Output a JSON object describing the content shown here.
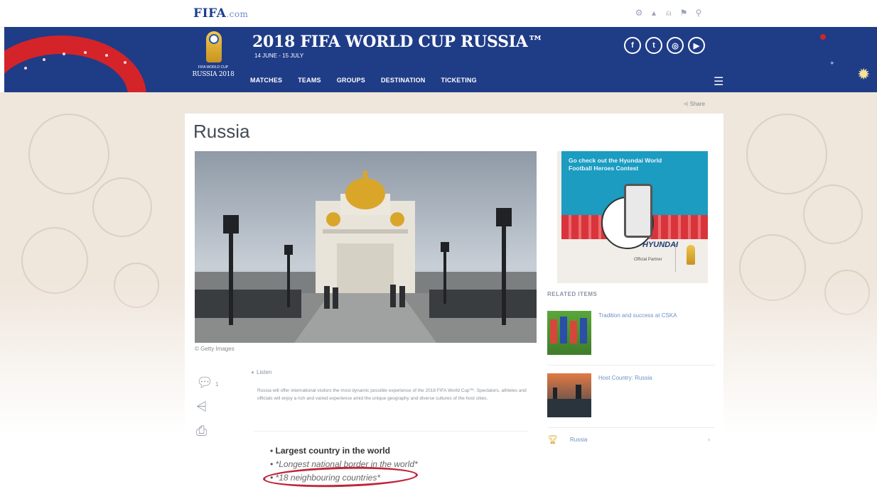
{
  "topbar": {
    "logo_main": "FIFA",
    "logo_suffix": ".com",
    "util_icons": [
      "settings-icon",
      "cart-icon",
      "user-icon",
      "language-icon",
      "search-icon"
    ],
    "util_glyphs": [
      "⚙",
      "▴",
      "⍝",
      "⚑",
      "⚲"
    ]
  },
  "masthead": {
    "title": "2018 FIFA WORLD CUP RUSSIA™",
    "dates": "14 JUNE - 15 JULY",
    "emblem_line1": "FIFA WORLD CUP",
    "emblem_line2": "RUSSIA 2018",
    "nav": [
      "MATCHES",
      "TEAMS",
      "GROUPS",
      "DESTINATION",
      "TICKETING"
    ],
    "social_glyphs": [
      "f",
      "t",
      "◎",
      "▶"
    ],
    "social_names": [
      "facebook-icon",
      "twitter-icon",
      "instagram-icon",
      "youtube-icon"
    ],
    "menu_glyph": "☰",
    "brand_color": "#1f3c87",
    "accent_red": "#d4242a"
  },
  "article": {
    "share_label": "Share",
    "title": "Russia",
    "image_caption": "© Getty Images",
    "comment_count": "1",
    "listen_label": "Listen",
    "lead": "Russia will offer international visitors the most dynamic possible experience of the 2018 FIFA World Cup™. Spectators, athletes and officials will enjoy a rich and varied experience amid the unique geography and diverse cultures of the host cities.",
    "bullets": [
      "Largest country in the world",
      "*Longest national border in the world*",
      "*18 neighbouring countries*"
    ]
  },
  "sidebar": {
    "ad_heading": "Go check out the Hyundai World Football Heroes Contest",
    "ad_brand": "HYUNDAI",
    "ad_brand_small": "Official Partner",
    "related_heading": "RELATED ITEMS",
    "related": [
      {
        "title": "Tradition and success at CSKA"
      },
      {
        "title": "Host Country: Russia"
      }
    ],
    "quick_link": "Russia"
  }
}
